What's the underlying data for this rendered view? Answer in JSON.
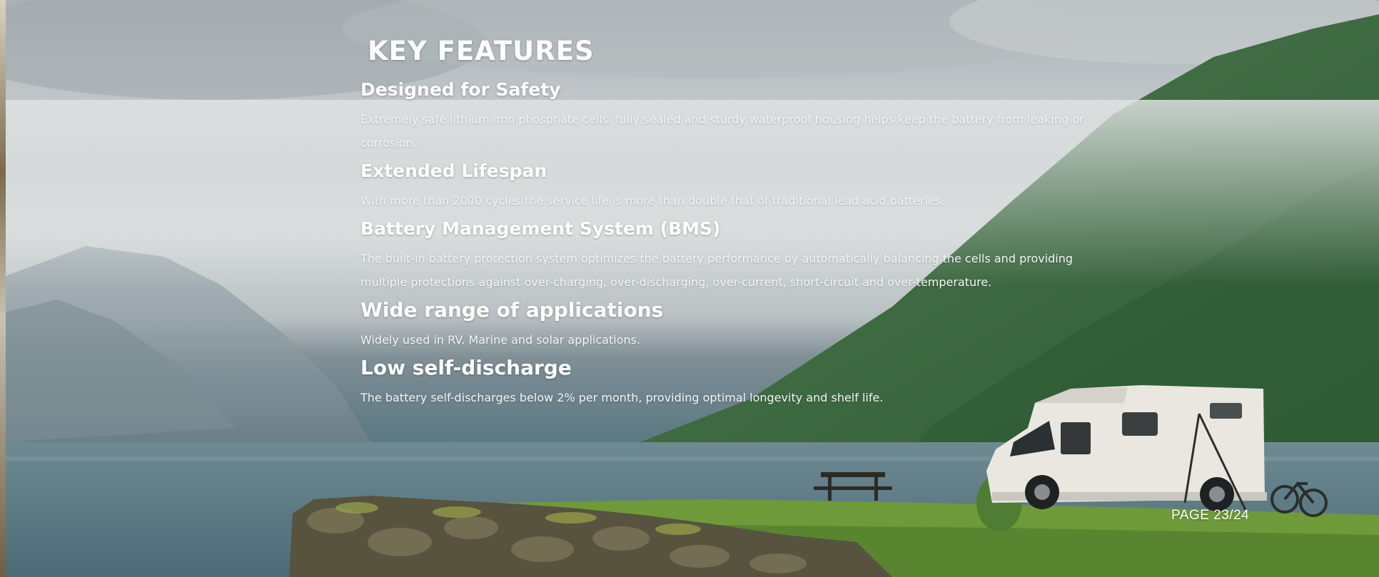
{
  "title": "KEY FEATURES",
  "features": [
    {
      "heading": "Designed for Safety",
      "description": "Extremely safe lithium iron phosphate cells. fully sealed and sturdy waterproof housing helps keep the battery from leaking or corrosion."
    },
    {
      "heading": "Extended Lifespan",
      "description": "With more than 2000 cycles the service life is more than double that of traditional lead acid batteries."
    },
    {
      "heading": "Battery Management System (BMS)",
      "description": "The built-in battery protection system optimizes the battery performance by automatically balancing the cells and providing multiple protections against over-charging, over-discharging, over-current, short-circuit and over-temperature."
    },
    {
      "heading": "Wide range of applications",
      "description": "Widely used in RV. Marine and solar applications."
    },
    {
      "heading": "Low self-discharge",
      "description": "The battery self-discharges below 2% per month, providing optimal longevity and shelf life."
    }
  ],
  "page_number": "PAGE 23/24",
  "colors": {
    "text": "#ffffff",
    "sky": "#c6cbcd",
    "lake": "#5e7a84",
    "mountain": "#3f6a45",
    "grass": "#6f9a3a"
  }
}
